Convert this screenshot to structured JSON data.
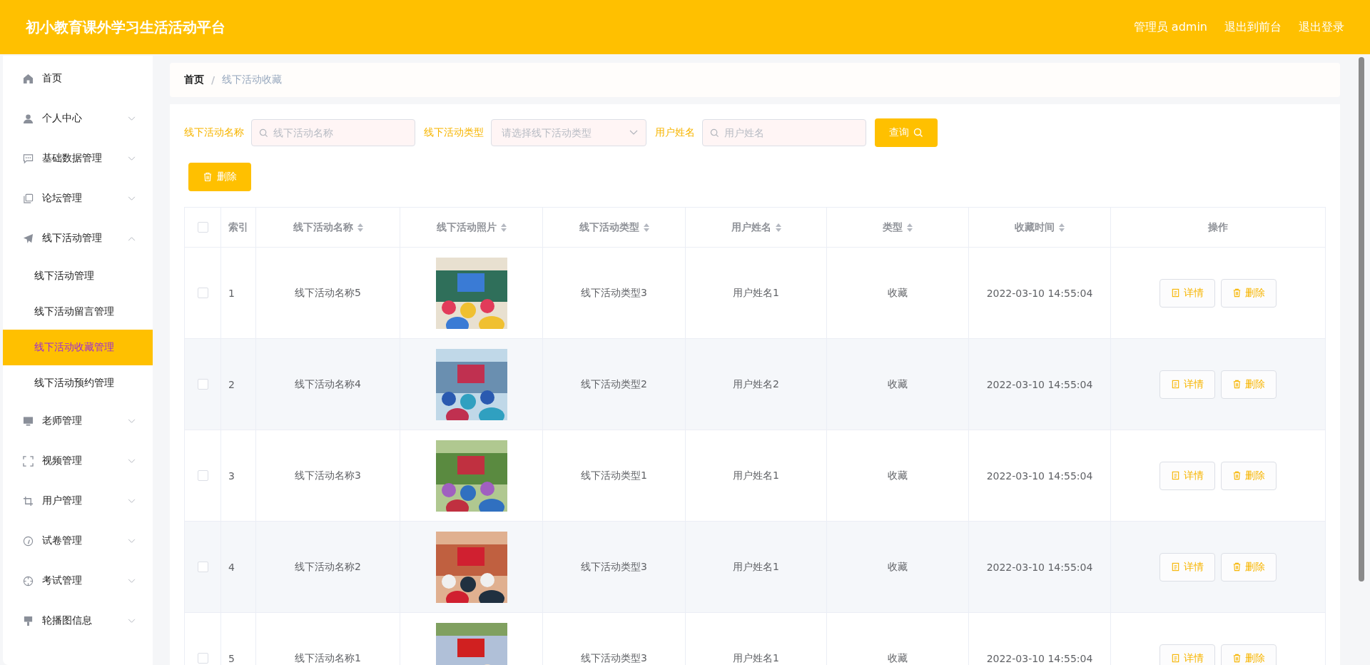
{
  "header": {
    "title": "初小教育课外学习生活活动平台",
    "links": [
      "管理员 admin",
      "退出到前台",
      "退出登录"
    ]
  },
  "sidebar": {
    "items": [
      {
        "label": "首页"
      },
      {
        "label": "个人中心",
        "expanded": false
      },
      {
        "label": "基础数据管理",
        "expanded": false
      },
      {
        "label": "论坛管理",
        "expanded": false
      },
      {
        "label": "线下活动管理",
        "expanded": true,
        "children": [
          {
            "label": "线下活动管理",
            "selected": false
          },
          {
            "label": "线下活动留言管理",
            "selected": false
          },
          {
            "label": "线下活动收藏管理",
            "selected": true
          },
          {
            "label": "线下活动预约管理",
            "selected": false
          }
        ]
      },
      {
        "label": "老师管理",
        "expanded": false
      },
      {
        "label": "视频管理",
        "expanded": false
      },
      {
        "label": "用户管理",
        "expanded": false
      },
      {
        "label": "试卷管理",
        "expanded": false
      },
      {
        "label": "考试管理",
        "expanded": false
      },
      {
        "label": "轮播图信息",
        "expanded": false
      }
    ]
  },
  "breadcrumb": {
    "separator": "/",
    "items": [
      "首页",
      "线下活动收藏"
    ]
  },
  "search": {
    "fields": [
      {
        "label": "线下活动名称",
        "kind": "text",
        "placeholder": "线下活动名称"
      },
      {
        "label": "线下活动类型",
        "kind": "select",
        "placeholder": "请选择线下活动类型"
      },
      {
        "label": "用户姓名",
        "kind": "text",
        "placeholder": "用户姓名"
      }
    ],
    "button": "查询"
  },
  "delete_button": "删除",
  "table": {
    "select_all_checked": false,
    "columns": [
      {
        "label": "索引",
        "sortable": false
      },
      {
        "label": "线下活动名称",
        "sortable": true
      },
      {
        "label": "线下活动照片",
        "sortable": true
      },
      {
        "label": "线下活动类型",
        "sortable": true
      },
      {
        "label": "用户姓名",
        "sortable": true
      },
      {
        "label": "类型",
        "sortable": true
      },
      {
        "label": "收藏时间",
        "sortable": true
      },
      {
        "label": "操作",
        "sortable": false
      }
    ],
    "rows": [
      {
        "checked": false,
        "index": "1",
        "name": "线下活动名称5",
        "photo": {
          "kind": "picture"
        },
        "type": "线下活动类型3",
        "user": "用户姓名1",
        "kind": "收藏",
        "time": "2022-03-10 14:55:04",
        "actions": [
          "详情",
          "删除"
        ]
      },
      {
        "checked": false,
        "index": "2",
        "name": "线下活动名称4",
        "photo": {
          "kind": "picture"
        },
        "type": "线下活动类型2",
        "user": "用户姓名2",
        "kind": "收藏",
        "time": "2022-03-10 14:55:04",
        "actions": [
          "详情",
          "删除"
        ]
      },
      {
        "checked": false,
        "index": "3",
        "name": "线下活动名称3",
        "photo": {
          "kind": "picture"
        },
        "type": "线下活动类型1",
        "user": "用户姓名1",
        "kind": "收藏",
        "time": "2022-03-10 14:55:04",
        "actions": [
          "详情",
          "删除"
        ]
      },
      {
        "checked": false,
        "index": "4",
        "name": "线下活动名称2",
        "photo": {
          "kind": "picture"
        },
        "type": "线下活动类型3",
        "user": "用户姓名1",
        "kind": "收藏",
        "time": "2022-03-10 14:55:04",
        "actions": [
          "详情",
          "删除"
        ]
      },
      {
        "checked": false,
        "index": "5",
        "name": "线下活动名称1",
        "photo": {
          "kind": "picture"
        },
        "type": "线下活动类型3",
        "user": "用户姓名1",
        "kind": "收藏",
        "time": "2022-03-10 14:55:04",
        "actions": [
          "详情",
          "删除"
        ]
      }
    ]
  }
}
